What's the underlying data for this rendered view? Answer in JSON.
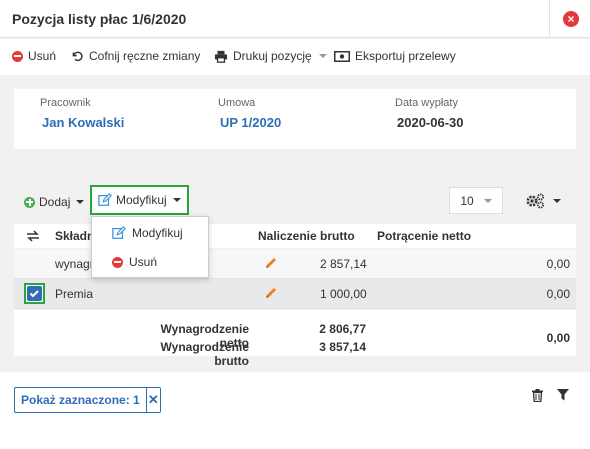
{
  "header": {
    "title": "Pozycja listy płac 1/6/2020"
  },
  "toolbar": {
    "delete_label": "Usuń",
    "undo_label": "Cofnij ręczne zmiany",
    "print_label": "Drukuj pozycję",
    "export_label": "Eksportuj przelewy"
  },
  "info": {
    "employee_label": "Pracownik",
    "employee_value": "Jan Kowalski",
    "contract_label": "Umowa",
    "contract_value": "UP 1/2020",
    "payday_label": "Data wypłaty",
    "payday_value": "2020-06-30"
  },
  "actions": {
    "add_label": "Dodaj",
    "modify_label": "Modyfikuj",
    "page_size": "10"
  },
  "dropdown": {
    "items": [
      {
        "label": "Modyfikuj",
        "icon": "edit-icon"
      },
      {
        "label": "Usuń",
        "icon": "minus-circle-icon"
      }
    ]
  },
  "table": {
    "columns": {
      "component": "Składn",
      "gross": "Naliczenie brutto",
      "net_deduction": "Potrącenie netto"
    },
    "rows": [
      {
        "name": "wynagr",
        "gross": "2 857,14",
        "deduction": "0,00",
        "checked": false
      },
      {
        "name": "Premia",
        "gross": "1 000,00",
        "deduction": "0,00",
        "checked": true
      }
    ],
    "summary": {
      "net_label": "Wynagrodzenie netto",
      "net_value": "2 806,77",
      "gross_label": "Wynagrodzenie brutto",
      "gross_value": "3 857,14",
      "deduction_total": "0,00"
    }
  },
  "footer": {
    "show_selected_label": "Pokaż zaznaczone: 1"
  },
  "colors": {
    "accent": "#2f6db5",
    "danger": "#e03a3a",
    "success": "#4caf50",
    "highlight": "#26a63d",
    "pencil": "#f07c1a"
  }
}
